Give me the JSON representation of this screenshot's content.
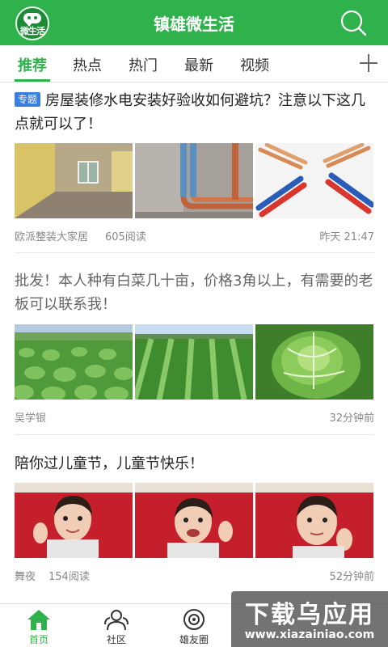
{
  "header": {
    "logo_text": "微生活",
    "title": "镇雄微生活",
    "icons": [
      "search-icon"
    ]
  },
  "tabs": [
    {
      "label": "推荐",
      "active": true
    },
    {
      "label": "热点",
      "active": false
    },
    {
      "label": "热门",
      "active": false
    },
    {
      "label": "最新",
      "active": false
    },
    {
      "label": "视频",
      "active": false
    }
  ],
  "feed": [
    {
      "badge": "专题",
      "title": "房屋装修水电安装好验收如何避坑？注意以下这几点就可以了！",
      "source": "欧派整装大家居",
      "reads": "605阅读",
      "time": "昨天 21:47",
      "images": [
        "room-under-renovation",
        "wall-water-pipes",
        "copper-wires"
      ]
    },
    {
      "badge": "",
      "title": "批发！本人种有白菜几十亩，价格3角以上，有需要的老板可以联系我！",
      "source": "吴学银",
      "reads": "",
      "time": "32分钟前",
      "images": [
        "cabbage-field",
        "cabbage-rows",
        "cabbage-closeup"
      ]
    },
    {
      "badge": "",
      "title": "陪你过儿童节，儿童节快乐！",
      "source": "舞夜",
      "reads": "154阅读",
      "time": "52分钟前",
      "images": [
        "child-photo-1",
        "child-photo-2",
        "child-photo-3"
      ]
    }
  ],
  "bottom_nav": [
    {
      "label": "首页",
      "icon": "home-icon",
      "active": true
    },
    {
      "label": "社区",
      "icon": "community-icon",
      "active": false
    },
    {
      "label": "雄友圈",
      "icon": "friends-circle-icon",
      "active": false
    }
  ],
  "watermark": {
    "text": "下载乌应用",
    "url": "www.xiazainiao.com"
  },
  "colors": {
    "brand_green": "#2fb24b",
    "badge_blue": "#3a7ee0"
  }
}
